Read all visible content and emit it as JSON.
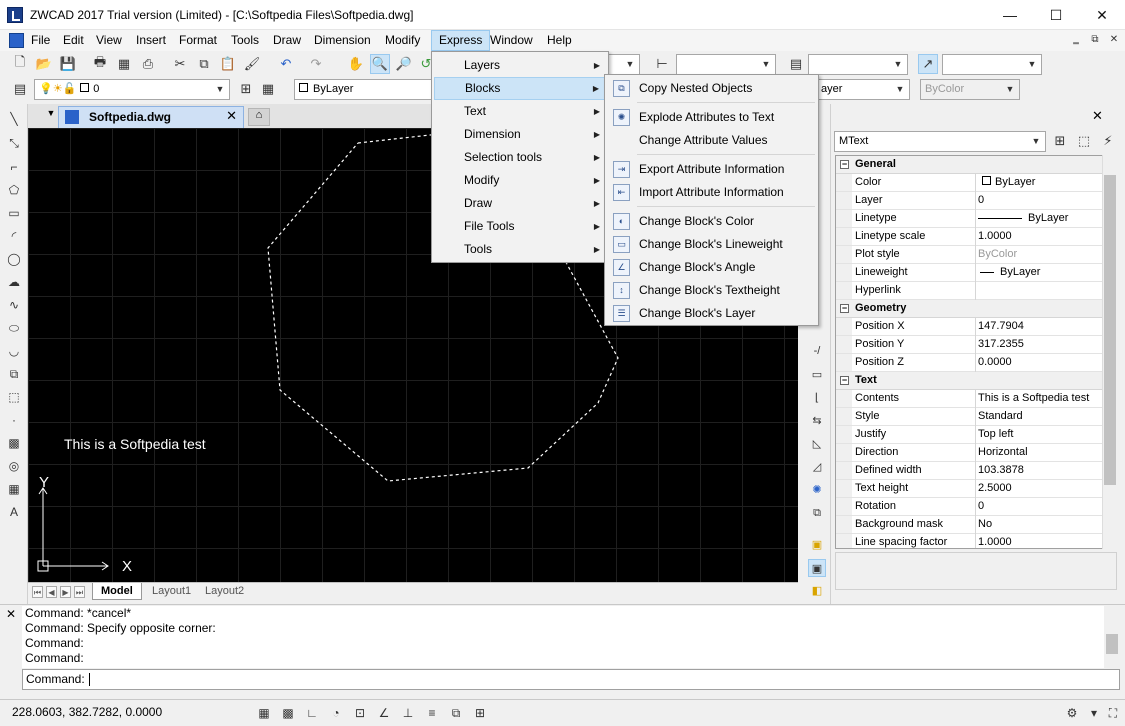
{
  "window": {
    "title": "ZWCAD 2017 Trial version (Limited) - [C:\\Softpedia Files\\Softpedia.dwg]",
    "minimize": "—",
    "maximize": "☐",
    "close": "✕"
  },
  "menubar": {
    "items": [
      "File",
      "Edit",
      "View",
      "Insert",
      "Format",
      "Tools",
      "Draw",
      "Dimension",
      "Modify",
      "Express",
      "Window",
      "Help"
    ],
    "active": "Express",
    "mdi": [
      "‗",
      "⧉",
      "✕"
    ]
  },
  "toolbar": {
    "layer_value": "0",
    "linetype_value": "ByLayer",
    "layer_color_value": "ayer",
    "plot_style_value": "ByColor"
  },
  "document_tab": {
    "name": "Softpedia.dwg",
    "close": "✕"
  },
  "drawing": {
    "text_object": "This is a Softpedia test",
    "ucs_x": "X",
    "ucs_y": "Y"
  },
  "layout_tabs": [
    "Model",
    "Layout1",
    "Layout2"
  ],
  "express_menu": {
    "items": [
      "Layers",
      "Blocks",
      "Text",
      "Dimension",
      "Selection tools",
      "Modify",
      "Draw",
      "File Tools",
      "Tools"
    ],
    "highlighted": "Blocks"
  },
  "blocks_submenu": {
    "items": [
      "Copy Nested Objects",
      "Explode Attributes to Text",
      "Change Attribute Values",
      "Export Attribute Information",
      "Import Attribute Information",
      "Change Block's Color",
      "Change Block's Lineweight",
      "Change Block's Angle",
      "Change Block's Textheight",
      "Change Block's Layer"
    ]
  },
  "properties": {
    "object_type": "MText",
    "categories": {
      "general": "General",
      "geometry": "Geometry",
      "text": "Text"
    },
    "general_rows": [
      {
        "label": "Color",
        "value": "ByLayer"
      },
      {
        "label": "Layer",
        "value": "0"
      },
      {
        "label": "Linetype",
        "value": "ByLayer"
      },
      {
        "label": "Linetype scale",
        "value": "1.0000"
      },
      {
        "label": "Plot style",
        "value": "ByColor"
      },
      {
        "label": "Lineweight",
        "value": "ByLayer"
      },
      {
        "label": "Hyperlink",
        "value": ""
      }
    ],
    "geometry_rows": [
      {
        "label": "Position X",
        "value": "147.7904"
      },
      {
        "label": "Position Y",
        "value": "317.2355"
      },
      {
        "label": "Position Z",
        "value": "0.0000"
      }
    ],
    "text_rows": [
      {
        "label": "Contents",
        "value": "This is a Softpedia test"
      },
      {
        "label": "Style",
        "value": "Standard"
      },
      {
        "label": "Justify",
        "value": "Top left"
      },
      {
        "label": "Direction",
        "value": "Horizontal"
      },
      {
        "label": "Defined width",
        "value": "103.3878"
      },
      {
        "label": "Text height",
        "value": "2.5000"
      },
      {
        "label": "Rotation",
        "value": "0"
      },
      {
        "label": "Background mask",
        "value": "No"
      },
      {
        "label": "Line spacing factor",
        "value": "1.0000"
      }
    ]
  },
  "command": {
    "history": [
      "Command: *cancel*",
      "Command: Specify opposite corner:",
      "Command:",
      "Command:"
    ],
    "prompt": "Command:"
  },
  "status": {
    "coordinates": "228.0603, 382.7282, 0.0000"
  },
  "colors": {
    "canvas": "#000000",
    "highlight": "#cce4f7",
    "accent": "#2a62c9"
  }
}
